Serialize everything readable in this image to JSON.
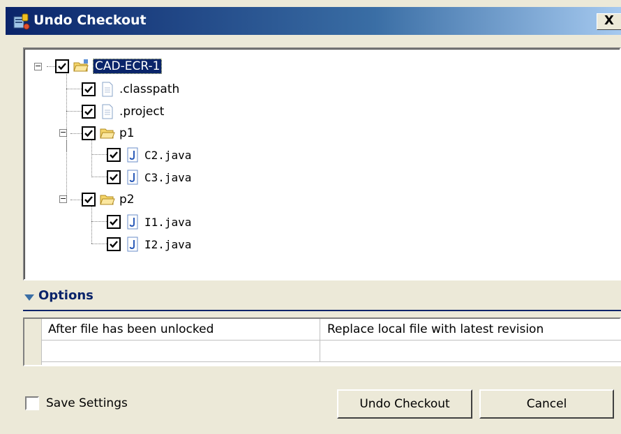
{
  "window": {
    "title": "Undo Checkout",
    "close_label": "X"
  },
  "tree": {
    "root": {
      "label": "CAD-ECR-1"
    },
    "items": [
      {
        "label": ".classpath"
      },
      {
        "label": ".project"
      },
      {
        "label": "p1"
      },
      {
        "label": "C2.java"
      },
      {
        "label": "C3.java"
      },
      {
        "label": "p2"
      },
      {
        "label": "I1.java"
      },
      {
        "label": "I2.java"
      }
    ]
  },
  "options": {
    "header": "Options",
    "rows": [
      {
        "setting": "After file has been unlocked",
        "value": "Replace local file with latest revision"
      },
      {
        "setting": "",
        "value": ""
      }
    ]
  },
  "footer": {
    "save_settings_label": "Save Settings",
    "undo_checkout_label": "Undo Checkout",
    "cancel_label": "Cancel"
  }
}
